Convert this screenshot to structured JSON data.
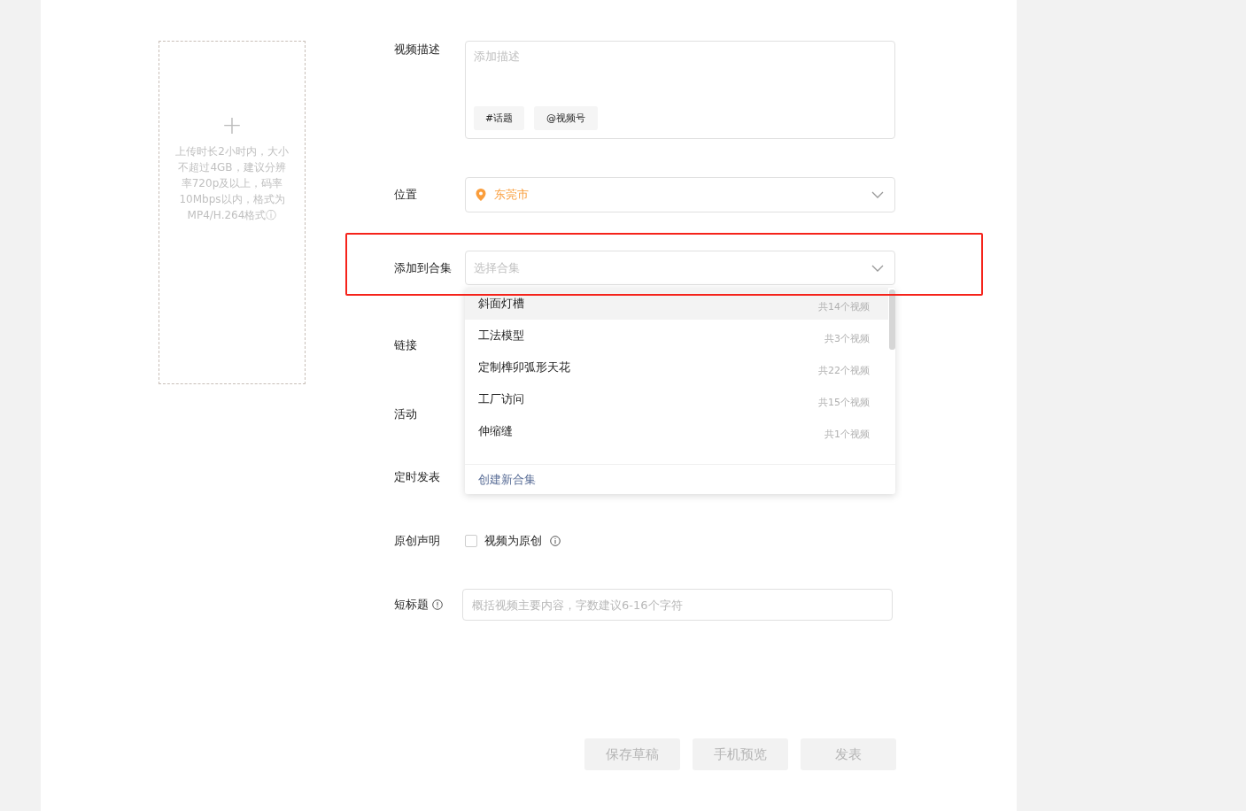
{
  "upload": {
    "plus": "+",
    "hint": "上传时长2小时内，大小不超过4GB，建议分辨率720p及以上，码率10Mbps以内，格式为MP4/H.264格式",
    "info": "ⓘ"
  },
  "description": {
    "label": "视频描述",
    "placeholder": "添加描述",
    "chips": [
      "#话题",
      "@视频号"
    ]
  },
  "location": {
    "label": "位置",
    "value": "东莞市"
  },
  "collection": {
    "label": "添加到合集",
    "placeholder": "选择合集",
    "options": [
      {
        "name": "斜面灯槽",
        "count": "共14个视频",
        "selected": true
      },
      {
        "name": "工法模型",
        "count": "共3个视频",
        "selected": false
      },
      {
        "name": "定制榫卯弧形天花",
        "count": "共22个视频",
        "selected": false
      },
      {
        "name": "工厂访问",
        "count": "共15个视频",
        "selected": false
      },
      {
        "name": "伸缩缝",
        "count": "共1个视频",
        "selected": false
      }
    ],
    "create": "创建新合集"
  },
  "link": {
    "label": "链接"
  },
  "activity": {
    "label": "活动"
  },
  "schedule": {
    "label": "定时发表"
  },
  "original": {
    "label": "原创声明",
    "checkbox": "视频为原创",
    "checked": false
  },
  "short_title": {
    "label": "短标题",
    "placeholder": "概括视频主要内容，字数建议6-16个字符"
  },
  "buttons": [
    "保存草稿",
    "手机预览",
    "发表"
  ]
}
